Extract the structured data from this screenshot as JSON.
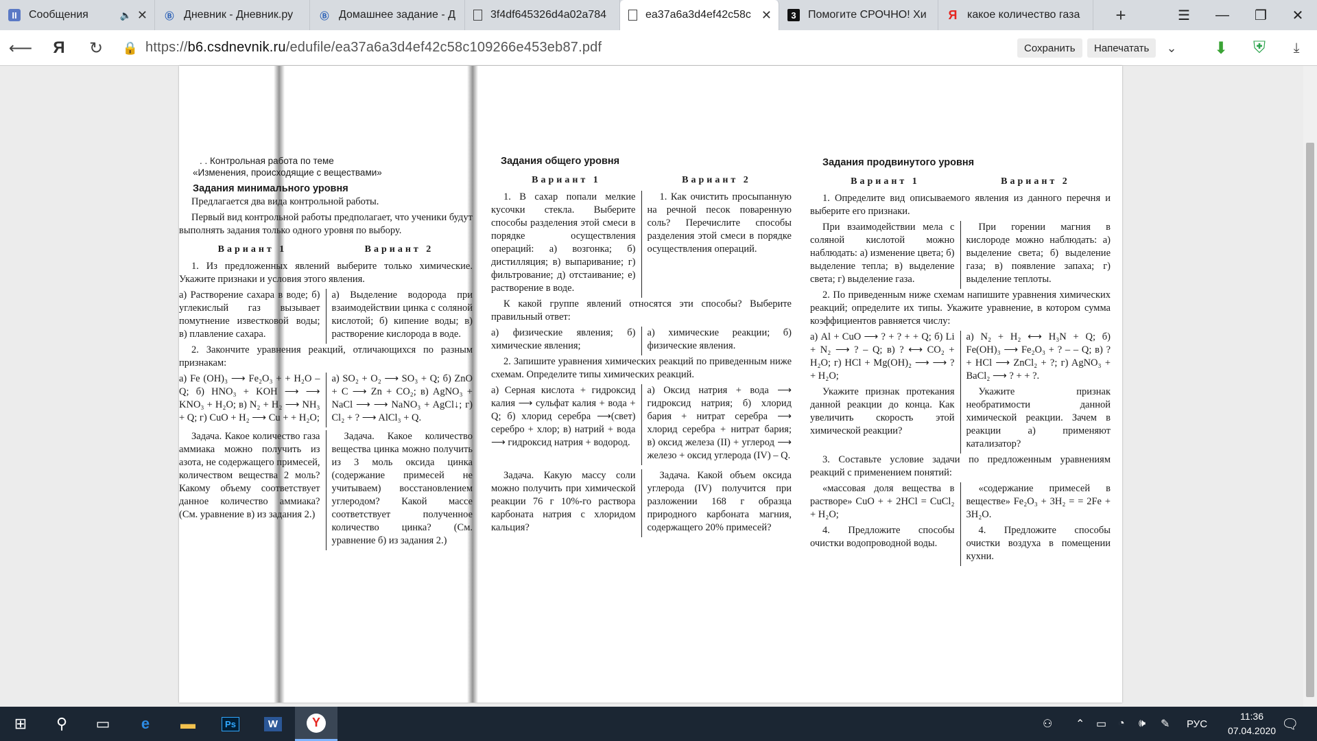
{
  "tabs": [
    {
      "title": "Сообщения",
      "favicon": "messages-icon",
      "extra": "🔈"
    },
    {
      "title": "Дневник - Дневник.ру",
      "favicon": "dnevnik-icon"
    },
    {
      "title": "Домашнее задание - Д",
      "favicon": "dnevnik-icon"
    },
    {
      "title": "3f4df645326d4a02a784",
      "favicon": "pdf-file-icon"
    },
    {
      "title": "ea37a6a3d4ef42c58c",
      "favicon": "pdf-file-icon"
    },
    {
      "title": "Помогите СРОЧНО! Хи",
      "favicon": "znanija-icon"
    },
    {
      "title": "какое количество газа",
      "favicon": "yandex-icon"
    }
  ],
  "address": {
    "scheme": "https://",
    "host": "b6.csdnevnik.ru",
    "path": "/edufile/ea37a6a3d4ef42c58c109266e453eb87.pdf"
  },
  "toolbar": {
    "save_label": "Сохранить",
    "print_label": "Напечатать"
  },
  "doc": {
    "col1": {
      "header1": ". . Контрольная работа по теме",
      "header2": "«Изменения, происходящие с веществами»",
      "section": "Задания минимального уровня",
      "intro1": "Предлагается два вида контрольной работы.",
      "intro2": "Первый вид контрольной работы предполагает, что ученики будут выполнять задания только одного уровня по выбору.",
      "var1": "Вариант 1",
      "var2": "Вариант 2",
      "q1": "1. Из предложенных явлений выберите только химические. Укажите признаки и условия этого явления.",
      "q1_v1": "а) Растворение сахара в воде; б) углекислый газ вызывает помутнение известковой воды; в) плавление сахара.",
      "q1_v2": "а) Выделение водорода при взаимодействии цинка с соляной кислотой; б) кипение воды; в) растворение кислорода в воде.",
      "q2": "2. Закончите уравнения реакций, отличающихся по разным признакам:",
      "q2_v1": "а) Fe (OH)₃ ⟶ Fe₂O₃ + + H₂O – Q; б) HNO₃ + KOH ⟶ ⟶ KNO₃ + H₂O; в) N₂ + H₂ ⟶ NH₃ + Q; г) CuO + H₂ ⟶ Cu + + H₂O;",
      "q2_v2": "а) SO₂ + O₂ ⟶ SO₃ + Q; б) ZnO + C ⟶ Zn + CO₂; в) AgNO₃ + NaCl ⟶ ⟶ NaNO₃ + AgCl↓; г) Cl₂ + ? ⟶ AlCl₃ + Q.",
      "task_v1": "Задача. Какое количество газа аммиака можно получить из азота, не содержащего примесей, количеством вещества 2 моль? Какому объему соответствует данное количество аммиака? (См. уравнение в) из задания 2.)",
      "task_v2": "Задача. Какое количество вещества цинка можно получить из 3 моль оксида цинка (содержание примесей не учитываем) восстановлением углеродом? Какой массе соответствует полученное количество цинка? (См. уравнение б) из задания 2.)"
    },
    "col2": {
      "section": "Задания общего уровня",
      "var1": "Вариант 1",
      "var2": "Вариант 2",
      "q1_v1": "1. В сахар попали мелкие кусочки стекла. Выберите способы разделения этой смеси в порядке осуществления операций: а) возгонка; б) дистилляция; в) выпаривание; г) фильтрование; д) отстаивание; е) растворение в воде.",
      "q1_v2": "1. Как очистить просыпанную на речной песок поваренную соль? Перечислите способы разделения этой смеси в порядке осуществления операций.",
      "q1b": "К какой группе явлений относятся эти способы? Выберите правильный ответ:",
      "q1b_v1": "а) физические явления; б) химические явления;",
      "q1b_v2": "а) химические реакции; б) физические явления.",
      "q2": "2. Запишите уравнения химических реакций по приведенным ниже схемам. Определите типы химических реакций.",
      "q2_v1": "а) Серная кислота + гидроксид калия ⟶ сульфат калия + вода + Q; б) хлорид серебра ⟶(свет) серебро + хлор; в) натрий + вода ⟶ гидроксид натрия + водород.",
      "q2_v2": "а) Оксид натрия + вода ⟶ гидроксид натрия; б) хлорид бария + нитрат серебра ⟶ хлорид серебра + нитрат бария; в) оксид железа (II) + углерод ⟶ железо + оксид углерода (IV) – Q.",
      "task_v1": "Задача. Какую массу соли можно получить при химической реакции 76 г 10%-го раствора карбоната натрия с хлоридом кальция?",
      "task_v2": "Задача. Какой объем оксида углерода (IV) получится при разложении 168 г образца природного карбоната магния, содержащего 20% примесей?"
    },
    "col3": {
      "section": "Задания продвинутого уровня",
      "var1": "Вариант 1",
      "var2": "Вариант 2",
      "q1": "1. Определите вид описываемого явления из данного перечня и выберите его признаки.",
      "q1_v1": "При взаимодействии мела с соляной кислотой можно наблюдать: а) изменение цвета; б) выделение тепла; в) выделение света; г) выделение газа.",
      "q1_v2": "При горении магния в кислороде можно наблюдать: а) выделение света; б) выделение газа; в) появление запаха; г) выделение теплоты.",
      "q2": "2. По приведенным ниже схемам напишите уравнения химических реакций; определите их типы. Укажите уравнение, в котором сумма коэффициентов равняется числу:",
      "q2_v1": "а) Al + CuO ⟶ ? + ? + + Q; б) Li + N₂ ⟶ ? – Q; в) ? ⟷ CO₂ + H₂O; г) HCl + Mg(OH)₂ ⟶ ⟶ ? + H₂O;",
      "q2_v2": "а) N₂ + H₂ ⟷ H₃N + Q; б) Fe(OH)₃ ⟶ Fe₂O₃ + ? – – Q; в) ? + HCl ⟶ ZnCl₂ + ?; г) AgNO₃ + BaCl₂ ⟶ ? + + ?.",
      "q2b_v1": "Укажите признак протекания данной реакции до конца. Как увеличить скорость этой химической реакции?",
      "q2b_v2": "Укажите признак необратимости данной химической реакции. Зачем в реакции а) применяют катализатор?",
      "q3": "3. Составьте условие задачи по предложенным уравнениям реакций с применением понятий:",
      "q3_v1": "«массовая доля вещества в растворе» CuO + + 2HCl = CuCl₂ + H₂O;",
      "q3_v2": "«содержание примесей в веществе» Fe₂O₃ + 3H₂ = = 2Fe + 3H₂O.",
      "q4_v1": "4. Предложите способы очистки водопроводной воды.",
      "q4_v2": "4. Предложите способы очистки воздуха в помещении кухни."
    }
  },
  "taskbar": {
    "apps": [
      "windows-start-icon",
      "search-icon",
      "task-view-icon",
      "edge-icon",
      "file-explorer-icon",
      "photoshop-icon",
      "word-icon",
      "yandex-browser-icon"
    ],
    "ps_label": "Ps",
    "word_label": "W",
    "lang": "РУС",
    "time": "11:36",
    "date": "07.04.2020"
  }
}
